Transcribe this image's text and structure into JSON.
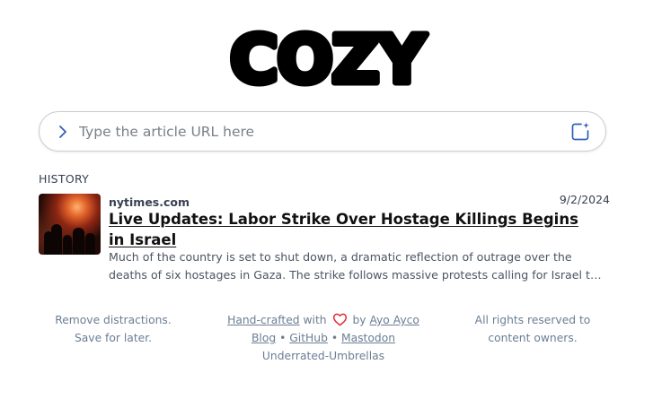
{
  "logo": {
    "text": "COZY"
  },
  "search": {
    "placeholder": "Type the article URL here",
    "value": "",
    "leading_icon": "chevron-right-icon",
    "trailing_icon": "add-square-sparkle-icon"
  },
  "history": {
    "label": "HISTORY",
    "items": [
      {
        "domain": "nytimes.com",
        "date": "9/2/2024",
        "title": "Live Updates: Labor Strike Over Hostage Killings Begins in Israel",
        "excerpt": "Much of the country is set to shut down, a dramatic reflection of outrage over the deaths of six hostages in Gaza. The strike follows massive protests calling for Israel to reach a hostage deal."
      }
    ]
  },
  "footer": {
    "left_line1": "Remove distractions.",
    "left_line2": "Save for later.",
    "handcrafted": "Hand-crafted",
    "with": "with",
    "by": "by",
    "author": "Ayo Ayco",
    "blog": "Blog",
    "sep1": "•",
    "github": "GitHub",
    "sep2": "•",
    "mastodon": "Mastodon",
    "org": "Underrated-Umbrellas",
    "right_line1": "All rights reserved to",
    "right_line2": "content owners."
  },
  "colors": {
    "accent_blue": "#2f5fb8",
    "heart_red": "#e0303a",
    "footer_text": "#6b7e94"
  }
}
